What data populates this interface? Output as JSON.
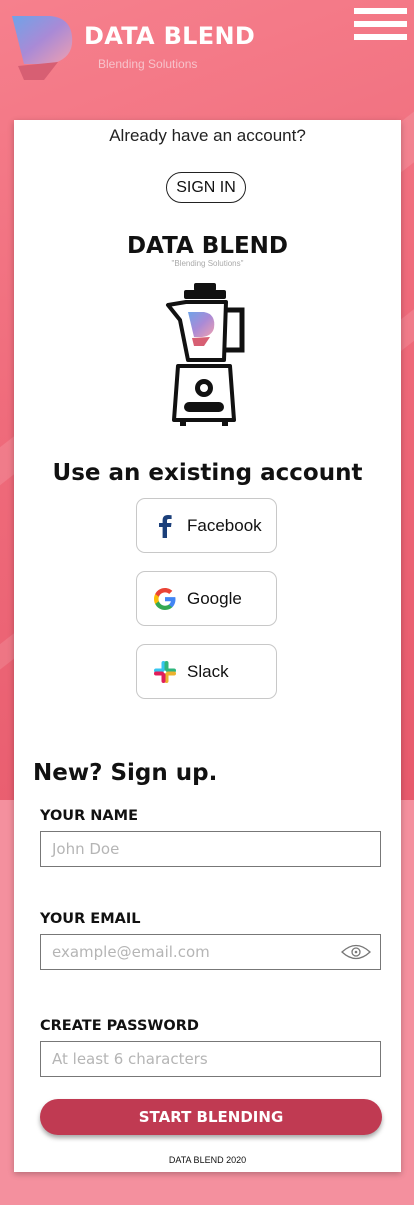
{
  "header": {
    "brand": "DATA BLEND",
    "tagline": "Blending Solutions"
  },
  "auth": {
    "have_account_text": "Already have an account?",
    "signin_label": "SIGN IN"
  },
  "logo": {
    "title": "DATA BLEND",
    "subtitle": "\"Blending Solutions\""
  },
  "existing": {
    "title": "Use an existing account",
    "providers": [
      {
        "label": "Facebook",
        "icon": "facebook-icon",
        "color": "#1877f2"
      },
      {
        "label": "Google",
        "icon": "google-icon",
        "color": "#4285f4"
      },
      {
        "label": "Slack",
        "icon": "slack-icon",
        "color": "#e01e5a"
      }
    ]
  },
  "signup": {
    "title": "New? Sign up.",
    "name_label": "YOUR NAME",
    "name_placeholder": "John Doe",
    "email_label": "YOUR EMAIL",
    "email_placeholder": "example@email.com",
    "password_label": "CREATE PASSWORD",
    "password_placeholder": "At least 6 characters",
    "submit_label": "START BLENDING"
  },
  "footer": {
    "text": "DATA BLEND 2020"
  },
  "colors": {
    "background": "#ef6b7b",
    "accent": "#c03a52",
    "card": "#ffffff"
  }
}
